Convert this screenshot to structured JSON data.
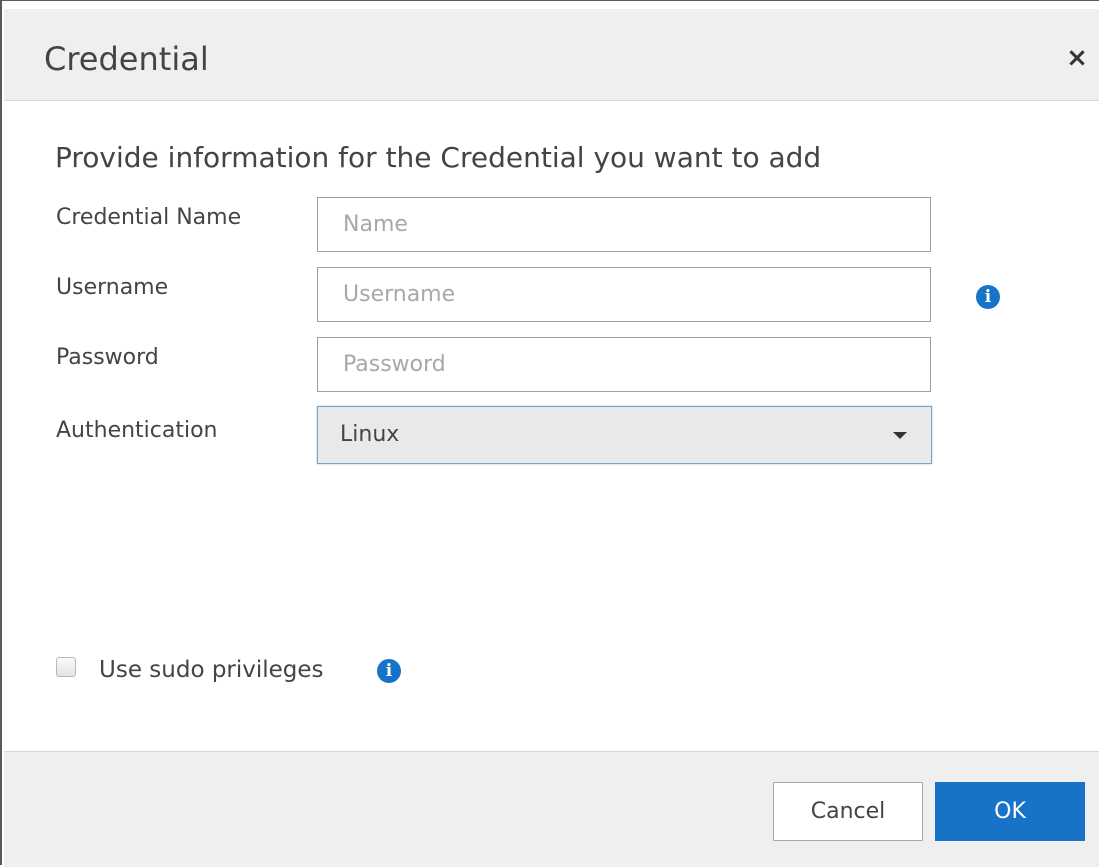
{
  "dialog": {
    "title": "Credential",
    "close_glyph": "×",
    "subtitle": "Provide information for the Credential you want to add"
  },
  "form": {
    "credential_name": {
      "label": "Credential Name",
      "placeholder": "Name",
      "value": ""
    },
    "username": {
      "label": "Username",
      "placeholder": "Username",
      "value": "",
      "info_icon": "info-circle-icon"
    },
    "password": {
      "label": "Password",
      "placeholder": "Password",
      "value": ""
    },
    "authentication": {
      "label": "Authentication",
      "selected": "Linux"
    },
    "sudo": {
      "label": "Use sudo privileges",
      "checked": false,
      "info_icon": "info-circle-icon"
    }
  },
  "footer": {
    "cancel_label": "Cancel",
    "ok_label": "OK"
  },
  "colors": {
    "accent": "#1673c7",
    "header_bg": "#efefef",
    "text": "#444444"
  }
}
